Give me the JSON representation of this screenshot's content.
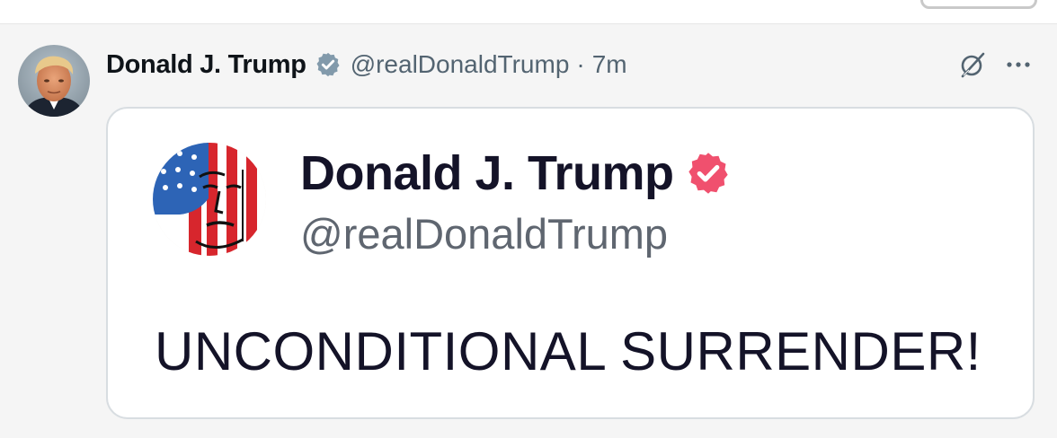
{
  "post": {
    "author": {
      "display_name": "Donald J. Trump",
      "handle": "@realDonaldTrump",
      "verified": true,
      "avatar_icon": "profile-photo-icon"
    },
    "separator": "·",
    "timestamp": "7m",
    "actions": {
      "grok_icon": "grok-icon",
      "more_icon": "more-options-icon"
    },
    "colors": {
      "x_verified_badge": "#829aab",
      "card_verified_badge": "#f0506e",
      "text_primary": "#0f1419",
      "text_secondary": "#536471"
    }
  },
  "embedded_card": {
    "display_name": "Donald J. Trump",
    "handle": "@realDonaldTrump",
    "verified": true,
    "avatar_icon": "flag-portrait-icon",
    "body_text": "UNCONDITIONAL SURRENDER!"
  }
}
